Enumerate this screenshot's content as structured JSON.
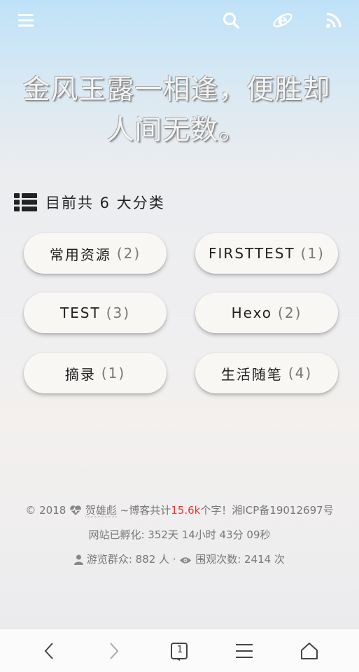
{
  "topbar": {
    "icons": [
      "menu-icon",
      "search-icon",
      "ie-browser-icon",
      "rss-icon"
    ]
  },
  "hero": {
    "line1": "金风玉露一相逢，便胜却",
    "line2": "人间无数。"
  },
  "categories": {
    "heading": "目前共 6 大分类",
    "items": [
      {
        "name": "常用资源",
        "count": "(2)"
      },
      {
        "name": "FIRSTTEST",
        "count": "(1)"
      },
      {
        "name": "TEST",
        "count": "(3)"
      },
      {
        "name": "Hexo",
        "count": "(2)"
      },
      {
        "name": "摘录",
        "count": "(1)"
      },
      {
        "name": "生活随笔",
        "count": "(4)"
      }
    ]
  },
  "footer": {
    "copyright": "©",
    "year": "2018",
    "author": "贺雄彪",
    "words_prefix": "~博客共计",
    "words_count": "15.6k",
    "words_suffix": "个字！",
    "icp": "湘ICP备19012697号",
    "uptime": "网站已孵化: 352天 14小时 43分 09秒",
    "visitors_label": "游览群众: 882 人",
    "separator": "·",
    "views_label": "围观次数: 2414 次",
    "accent_color": "#e53935"
  },
  "navbar": {
    "tab_count": "1",
    "icons": [
      "back-icon",
      "forward-icon",
      "tabs-icon",
      "menu-icon",
      "home-icon"
    ]
  }
}
